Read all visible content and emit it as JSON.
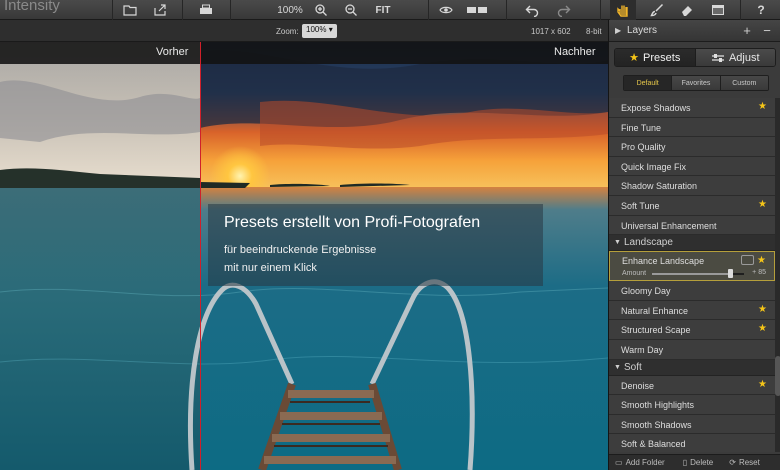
{
  "app": {
    "title": "Intensity"
  },
  "toolbar": {
    "zoom_percent": "100%",
    "fit_label": "FIT",
    "tools": [
      "folder-icon",
      "share-icon",
      "print-icon",
      "zoom-in-icon",
      "zoom-out-icon",
      "eye-icon",
      "compare-icon",
      "undo-icon",
      "redo-icon",
      "hand-icon",
      "brush-icon",
      "eraser-icon",
      "window-icon",
      "help-icon"
    ]
  },
  "statusbar": {
    "zoom_label": "Zoom:",
    "zoom_value": "100%",
    "dimensions": "1017 x 602",
    "bit_depth": "8-bit"
  },
  "compare": {
    "before_label": "Vorher",
    "after_label": "Nachher"
  },
  "overlay": {
    "title": "Presets erstellt von Profi-Fotografen",
    "line1": "für beeindruckende Ergebnisse",
    "line2": "mit nur einem Klick"
  },
  "panel": {
    "layers_title": "Layers",
    "tab_presets": "Presets",
    "tab_adjust": "Adjust",
    "filters": [
      "Default",
      "Favorites",
      "Custom"
    ],
    "selected_filter": "Default",
    "list_top": [
      {
        "label": "Expose Shadows",
        "star": true
      },
      {
        "label": "Fine Tune",
        "star": false
      },
      {
        "label": "Pro Quality",
        "star": false
      },
      {
        "label": "Quick Image Fix",
        "star": false
      },
      {
        "label": "Shadow Saturation",
        "star": false
      },
      {
        "label": "Soft Tune",
        "star": true
      },
      {
        "label": "Universal Enhancement",
        "star": false
      }
    ],
    "group_landscape": "Landscape",
    "selected_item": {
      "label": "Enhance Landscape",
      "amount_label": "Amount",
      "amount_value": "+ 85",
      "amount_fraction": 0.85,
      "star": true
    },
    "list_landscape": [
      {
        "label": "Gloomy Day",
        "star": false
      },
      {
        "label": "Natural Enhance",
        "star": true
      },
      {
        "label": "Structured Scape",
        "star": true
      },
      {
        "label": "Warm Day",
        "star": false
      }
    ],
    "group_soft": "Soft",
    "list_soft": [
      {
        "label": "Denoise",
        "star": true
      },
      {
        "label": "Smooth Highlights",
        "star": false
      },
      {
        "label": "Smooth Shadows",
        "star": false
      },
      {
        "label": "Soft & Balanced",
        "star": false
      }
    ],
    "footer": {
      "add_folder": "Add Folder",
      "delete": "Delete",
      "reset": "Reset"
    }
  },
  "colors": {
    "accent_star": "#f5c518",
    "divider": "#d0202a",
    "selected_border": "#b59f3b"
  }
}
